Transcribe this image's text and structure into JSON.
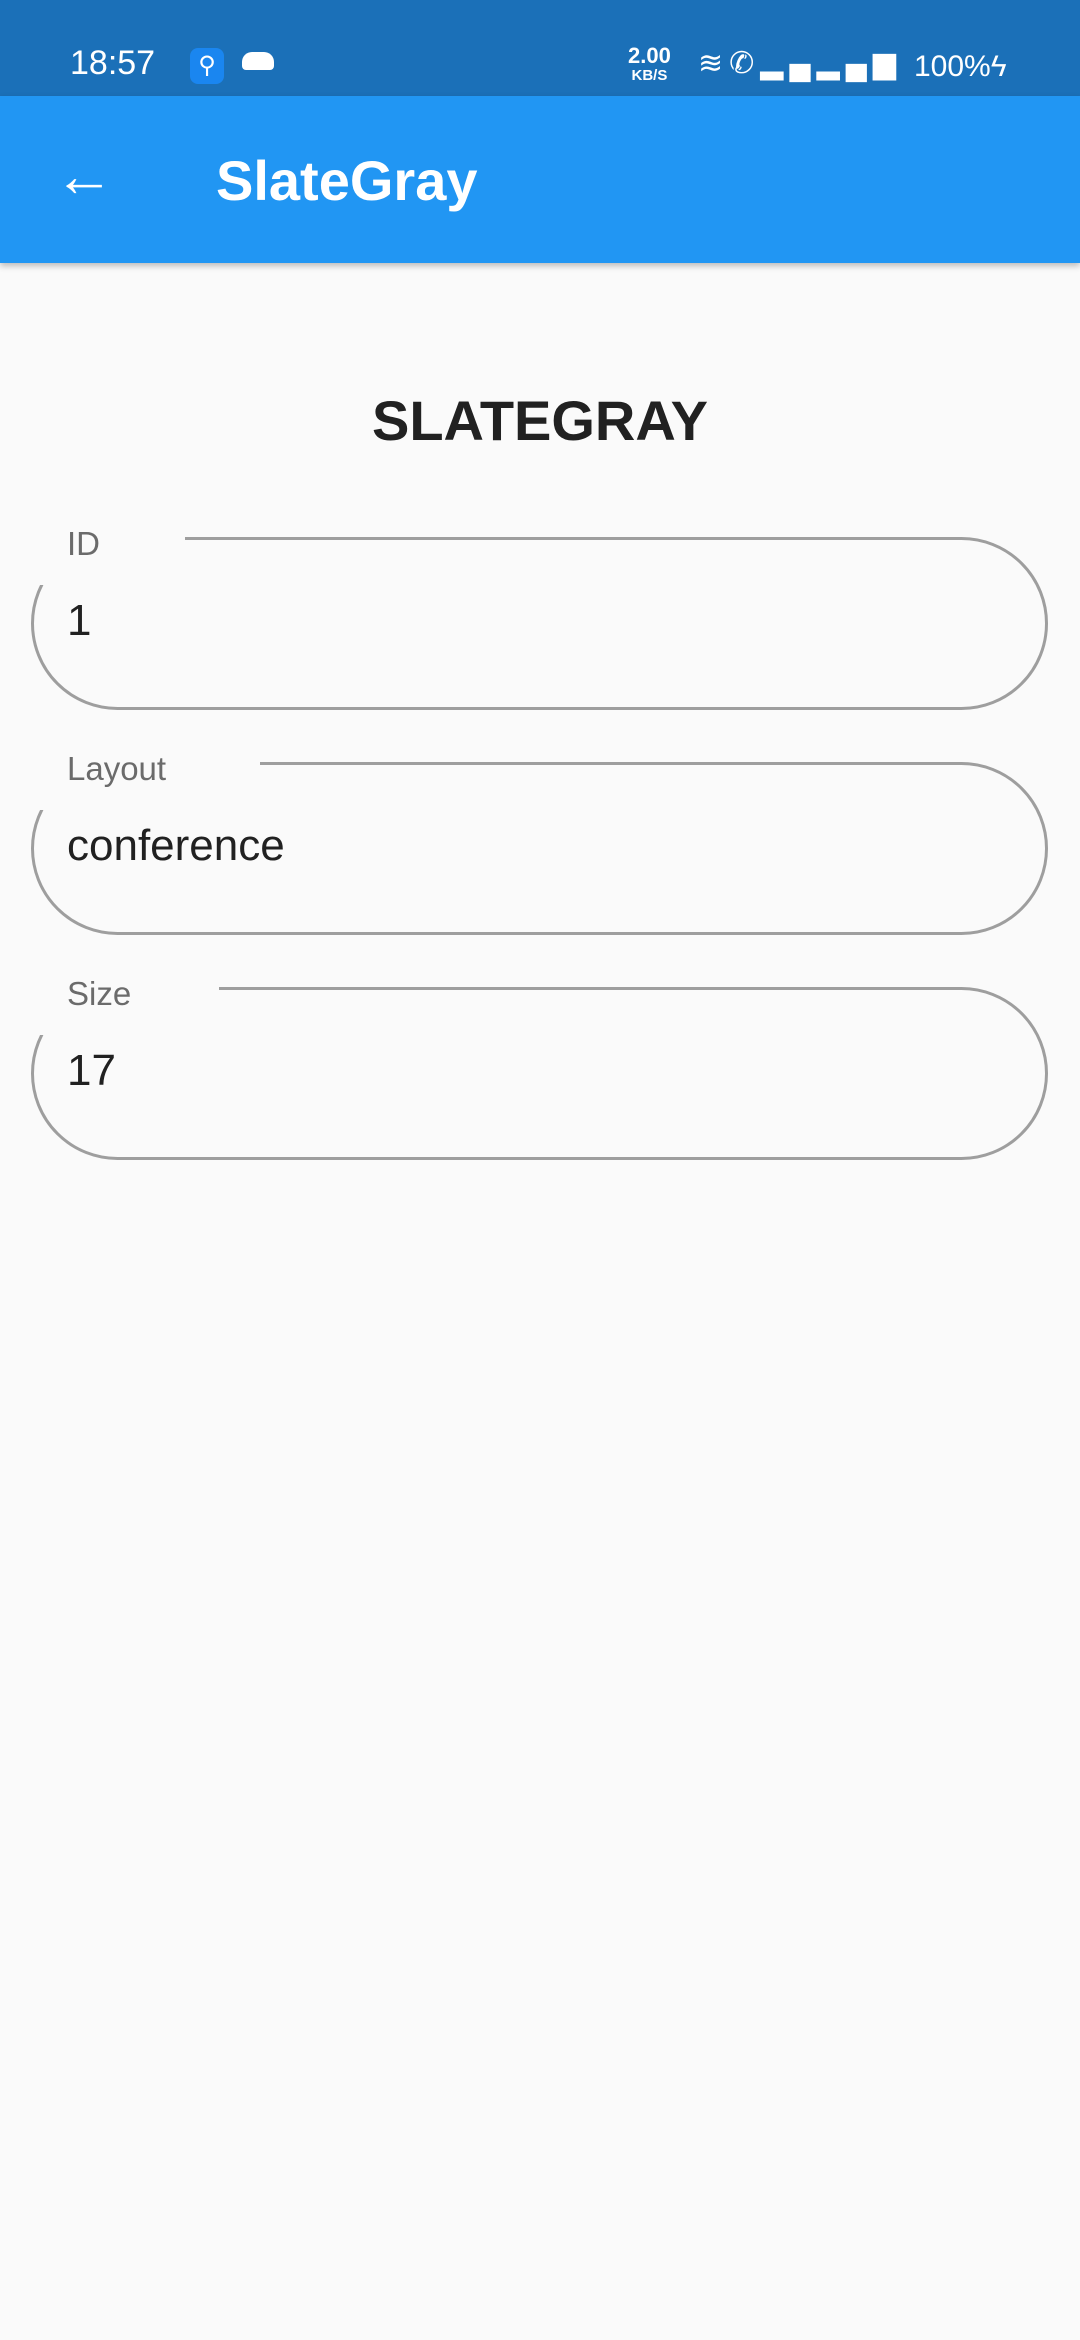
{
  "status_bar": {
    "time": "18:57",
    "net_rate": "2.00",
    "net_unit": "KB/S",
    "battery": "100%",
    "icons": [
      "usb-icon",
      "cloud-icon",
      "wifi-icon",
      "wifi-call-icon",
      "signal-icon",
      "signal-icon",
      "charging-icon"
    ]
  },
  "app_bar": {
    "title": "SlateGray",
    "back_icon": "arrow-left-icon"
  },
  "heading": "SLATEGRAY",
  "fields": [
    {
      "label": "ID",
      "value": "1"
    },
    {
      "label": "Layout",
      "value": "conference"
    },
    {
      "label": "Size",
      "value": "17"
    }
  ],
  "colors": {
    "status_bar": "#1b70b8",
    "app_bar": "#2196f3",
    "border": "#9e9e9e"
  }
}
